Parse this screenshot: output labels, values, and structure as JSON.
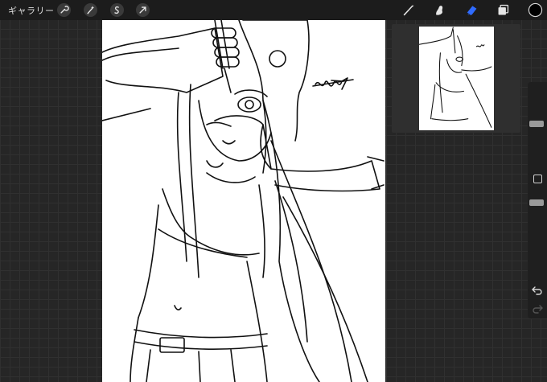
{
  "toolbar": {
    "gallery_label": "ギャラリー",
    "left_icons": [
      "wrench-icon",
      "magic-wand-icon",
      "selection-icon",
      "transform-arrow-icon"
    ],
    "right_icons": [
      "brush-icon",
      "smudge-icon",
      "eraser-icon",
      "layers-icon",
      "color-swatch-icon"
    ],
    "active_tool": "eraser",
    "active_color": "#000000",
    "accent_color": "#2f6bff"
  },
  "reference_panel": {
    "icons": [
      "reference-thumbnail"
    ]
  },
  "sidebar": {
    "size_slider": 0.25,
    "opacity_slider": 0.6,
    "icons": [
      "undo-icon",
      "redo-icon"
    ]
  }
}
